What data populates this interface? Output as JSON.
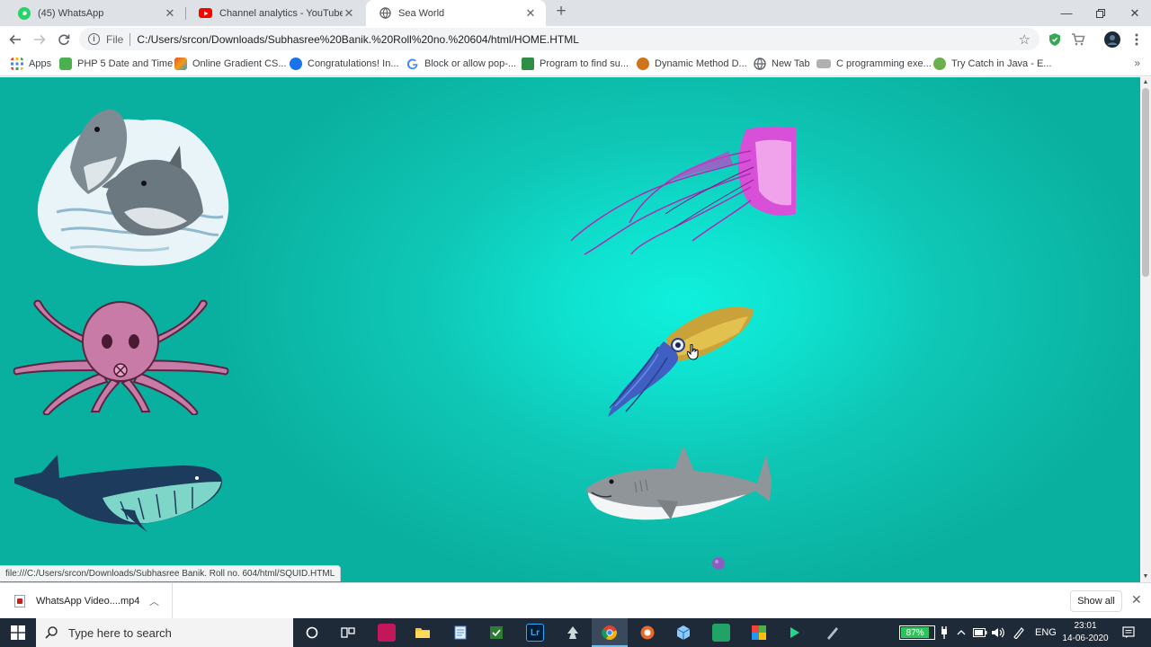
{
  "tabs": [
    {
      "title": "(45) WhatsApp",
      "favicon": "whatsapp-icon",
      "color": "#25d366"
    },
    {
      "title": "Channel analytics - YouTube Studio",
      "favicon": "youtube-icon",
      "color": "#ff0000"
    },
    {
      "title": "Sea World",
      "favicon": "globe-icon",
      "color": "#5f6368"
    }
  ],
  "toolbar": {
    "scheme": "File",
    "url": "C:/Users/srcon/Downloads/Subhasree%20Banik.%20Roll%20no.%20604/html/HOME.HTML"
  },
  "bookmarks": [
    {
      "label": "Apps",
      "icon": "apps-grid-icon",
      "color": "#4285f4"
    },
    {
      "label": "PHP 5 Date and Time",
      "icon": "w3-icon",
      "color": "#4caf50"
    },
    {
      "label": "Online Gradient CS...",
      "icon": "cube-icon",
      "color": "#e67e22"
    },
    {
      "label": "Congratulations! In...",
      "icon": "codeforces-icon",
      "color": "#1a73e8"
    },
    {
      "label": "Block or allow pop-...",
      "icon": "google-icon",
      "color": "#ea4335"
    },
    {
      "label": "Program to find su...",
      "icon": "gfg-icon",
      "color": "#2f8d46"
    },
    {
      "label": "Dynamic Method D...",
      "icon": "owl-icon",
      "color": "#d0741c"
    },
    {
      "label": "New Tab",
      "icon": "globe-icon",
      "color": "#5f6368"
    },
    {
      "label": "C programming exe...",
      "icon": "w3r-icon",
      "color": "#888888"
    },
    {
      "label": "Try Catch in Java - E...",
      "icon": "b-icon",
      "color": "#6ab04c"
    }
  ],
  "page": {
    "status_url": "file:///C:/Users/srcon/Downloads/Subhasree Banik. Roll no. 604/html/SQUID.HTML"
  },
  "download": {
    "filename": "WhatsApp Video....mp4",
    "show_all": "Show all"
  },
  "taskbar": {
    "search_placeholder": "Type here to search",
    "battery_percent": "87%",
    "battery_level": 0.87,
    "language": "ENG",
    "time": "23:01",
    "date": "14-06-2020"
  },
  "colors": {
    "page_bg": "#0fc7b6",
    "taskbar": "#1f2a38",
    "battery_fill": "#2ec45b"
  }
}
